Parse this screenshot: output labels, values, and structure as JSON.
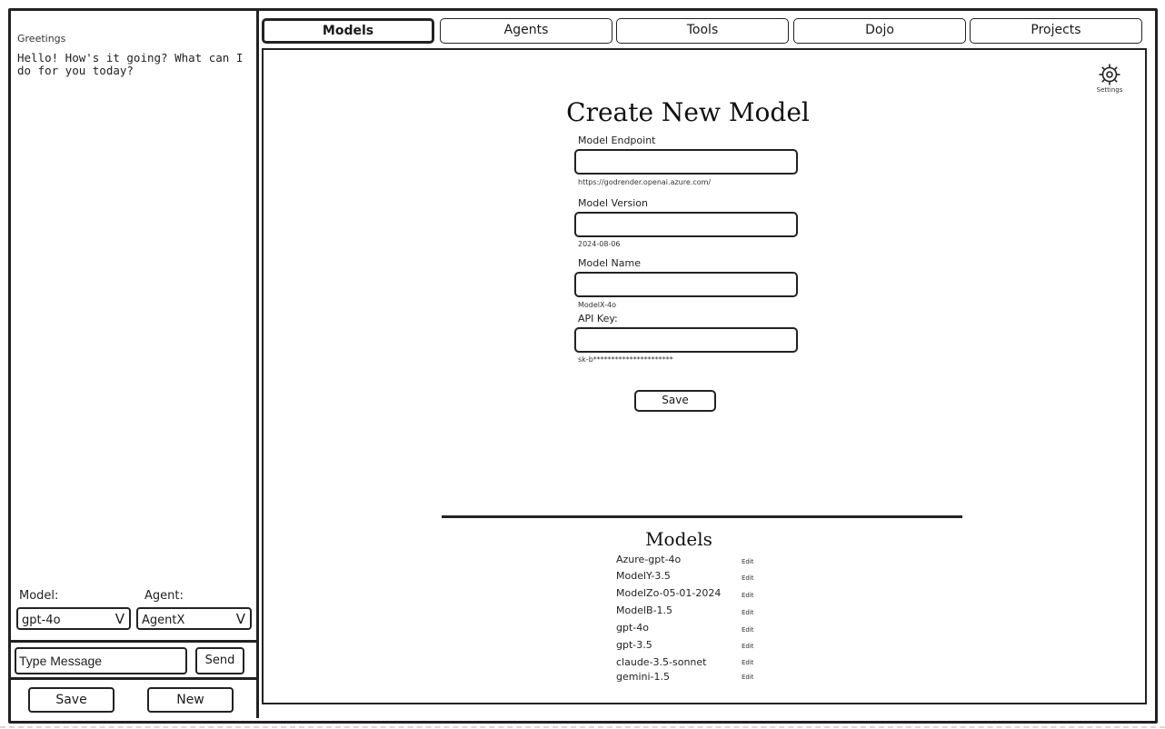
{
  "sidebar": {
    "greeting_title": "Greetings",
    "greeting_message": "Hello! How's it going? What can I do for you today?",
    "model_label": "Model:",
    "model_value": "gpt-4o",
    "agent_label": "Agent:",
    "agent_value": "AgentX",
    "message_placeholder": "Type Message",
    "send_label": "Send",
    "save_label": "Save",
    "new_label": "New",
    "caret": "V"
  },
  "tabs": [
    "Models",
    "Agents",
    "Tools",
    "Dojo",
    "Projects"
  ],
  "active_tab": "Models",
  "settings_label": "Settings",
  "form": {
    "title": "Create New Model",
    "fields": [
      {
        "label": "Model Endpoint",
        "hint": "https://godrender.openai.azure.com/"
      },
      {
        "label": "Model Version",
        "hint": "2024-08-06"
      },
      {
        "label": "Model Name",
        "hint": "ModelX-4o"
      },
      {
        "label": "API Key:",
        "hint": "sk-b**********************"
      }
    ],
    "save_label": "Save"
  },
  "models_list": {
    "title": "Models",
    "edit_label": "Edit",
    "items": [
      "Azure-gpt-4o",
      "ModelY-3.5",
      "ModelZo-05-01-2024",
      "ModelB-1.5",
      "gpt-4o",
      "gpt-3.5",
      "claude-3.5-sonnet",
      "gemini-1.5"
    ]
  }
}
